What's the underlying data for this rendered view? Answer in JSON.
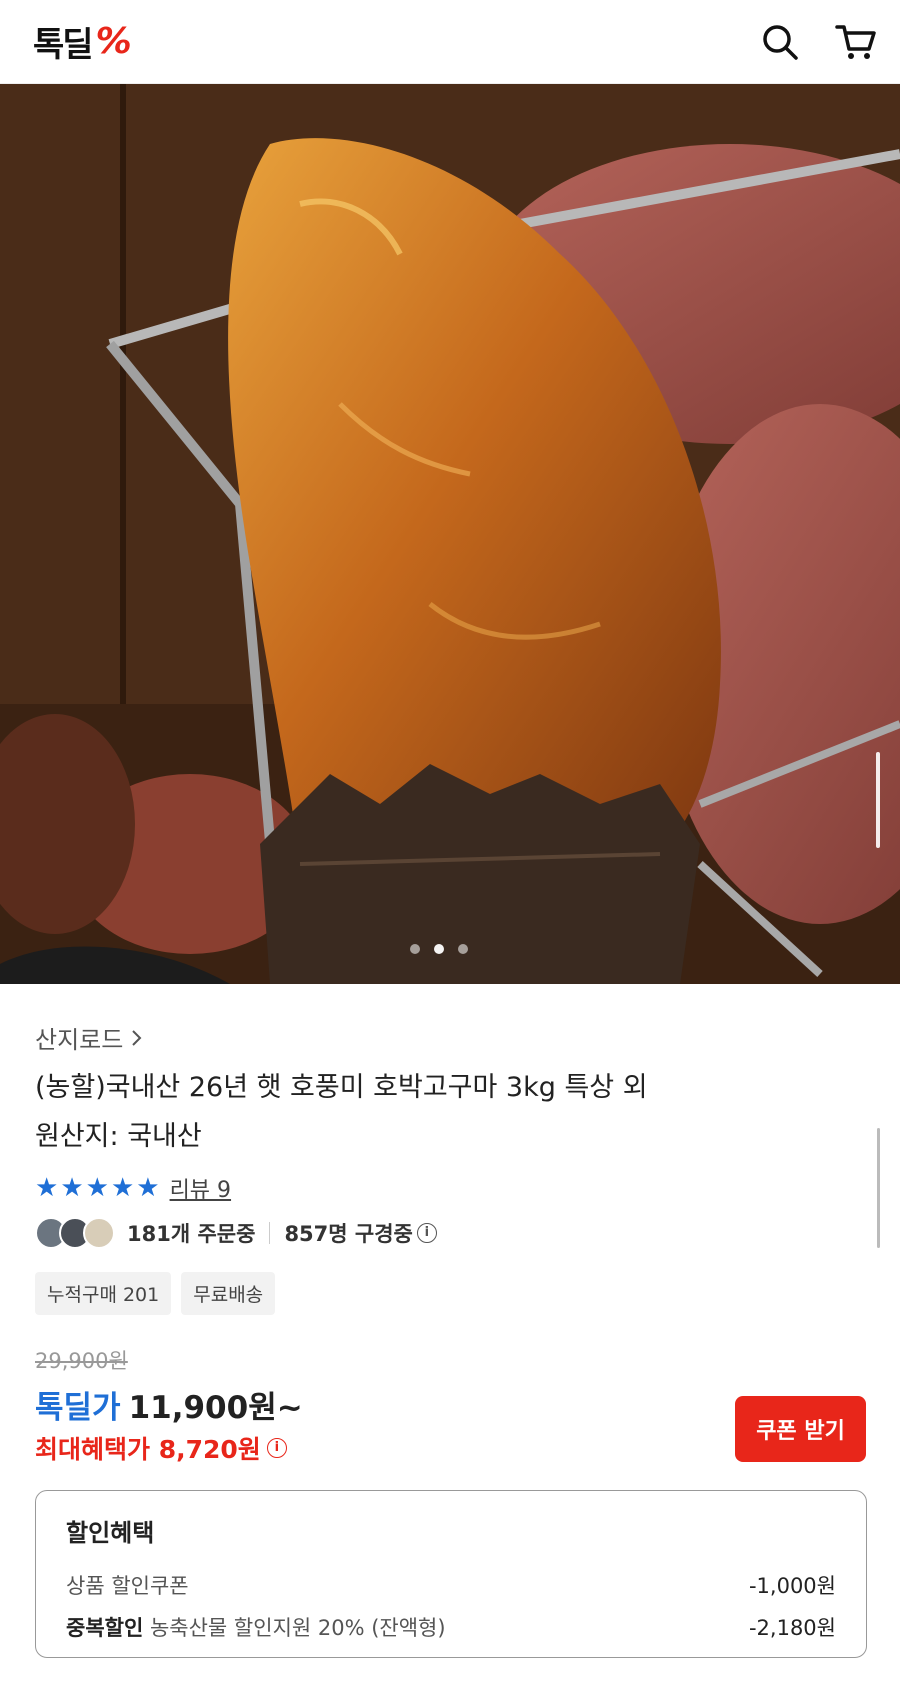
{
  "header": {
    "logo_text": "톡딜",
    "logo_mark": "%",
    "icons": [
      "search-icon",
      "cart-icon"
    ]
  },
  "hero": {
    "carousel_dots": 3,
    "active_dot": 1
  },
  "product": {
    "brand": "산지로드",
    "title": "(농할)국내산 26년 햇 호풍미 호박고구마 3kg 특상 외",
    "origin": "원산지: 국내산",
    "rating_stars": 5,
    "review_label": "리뷰 9",
    "order_count": "181개 주문중",
    "viewers": "857명 구경중",
    "chips": [
      "누적구매 201",
      "무료배송"
    ]
  },
  "price": {
    "original": "29,900원",
    "deal_label": "톡딜가",
    "deal_price": "11,900원~",
    "max_benefit": "최대혜택가 8,720원",
    "coupon_button": "쿠폰 받기"
  },
  "benefits": {
    "title": "할인혜택",
    "rows": [
      {
        "bold": "",
        "label": "상품 할인쿠폰",
        "amount": "-1,000원"
      },
      {
        "bold": "중복할인",
        "label": "농축산물 할인지원 20% (잔액형)",
        "amount": "-2,180원"
      }
    ]
  },
  "colors": {
    "brand_red": "#e8261a",
    "deal_blue": "#1f6fd6"
  }
}
